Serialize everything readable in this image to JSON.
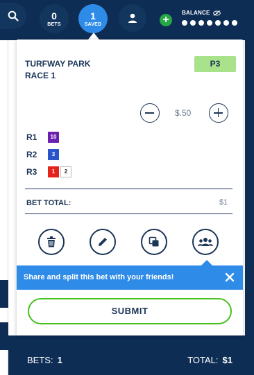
{
  "header": {
    "bets": {
      "count": "0",
      "label": "BETS"
    },
    "saved": {
      "count": "1",
      "label": "SAVED"
    },
    "balance_label": "BALANCE",
    "balance_masked": "●●●●●●●"
  },
  "bet_card": {
    "track": "TURFWAY PARK",
    "race": "RACE 1",
    "bet_type": "P3",
    "amount": "$.50",
    "legs": [
      {
        "label": "R1",
        "picks": [
          {
            "number": "10",
            "color": "#6a1fb0"
          }
        ]
      },
      {
        "label": "R2",
        "picks": [
          {
            "number": "3",
            "color": "#2a55c9"
          }
        ]
      },
      {
        "label": "R3",
        "picks": [
          {
            "number": "1",
            "color": "#e5231b"
          },
          {
            "number": "2",
            "color": "#ffffff"
          }
        ]
      }
    ],
    "total_label": "BET TOTAL:",
    "total_value": "$1",
    "actions": [
      "trash-icon",
      "pencil-icon",
      "copy-icon",
      "group-icon"
    ],
    "share_message": "Share and split this bet with your friends!",
    "submit_label": "SUBMIT"
  },
  "footer": {
    "bets_label": "BETS:",
    "bets_value": "1",
    "total_label": "TOTAL:",
    "total_value": "$1"
  },
  "colors": {
    "navy": "#0e2d55",
    "accent_blue": "#2f8be8",
    "green": "#46c11e",
    "tag_green": "#a8e28a"
  }
}
